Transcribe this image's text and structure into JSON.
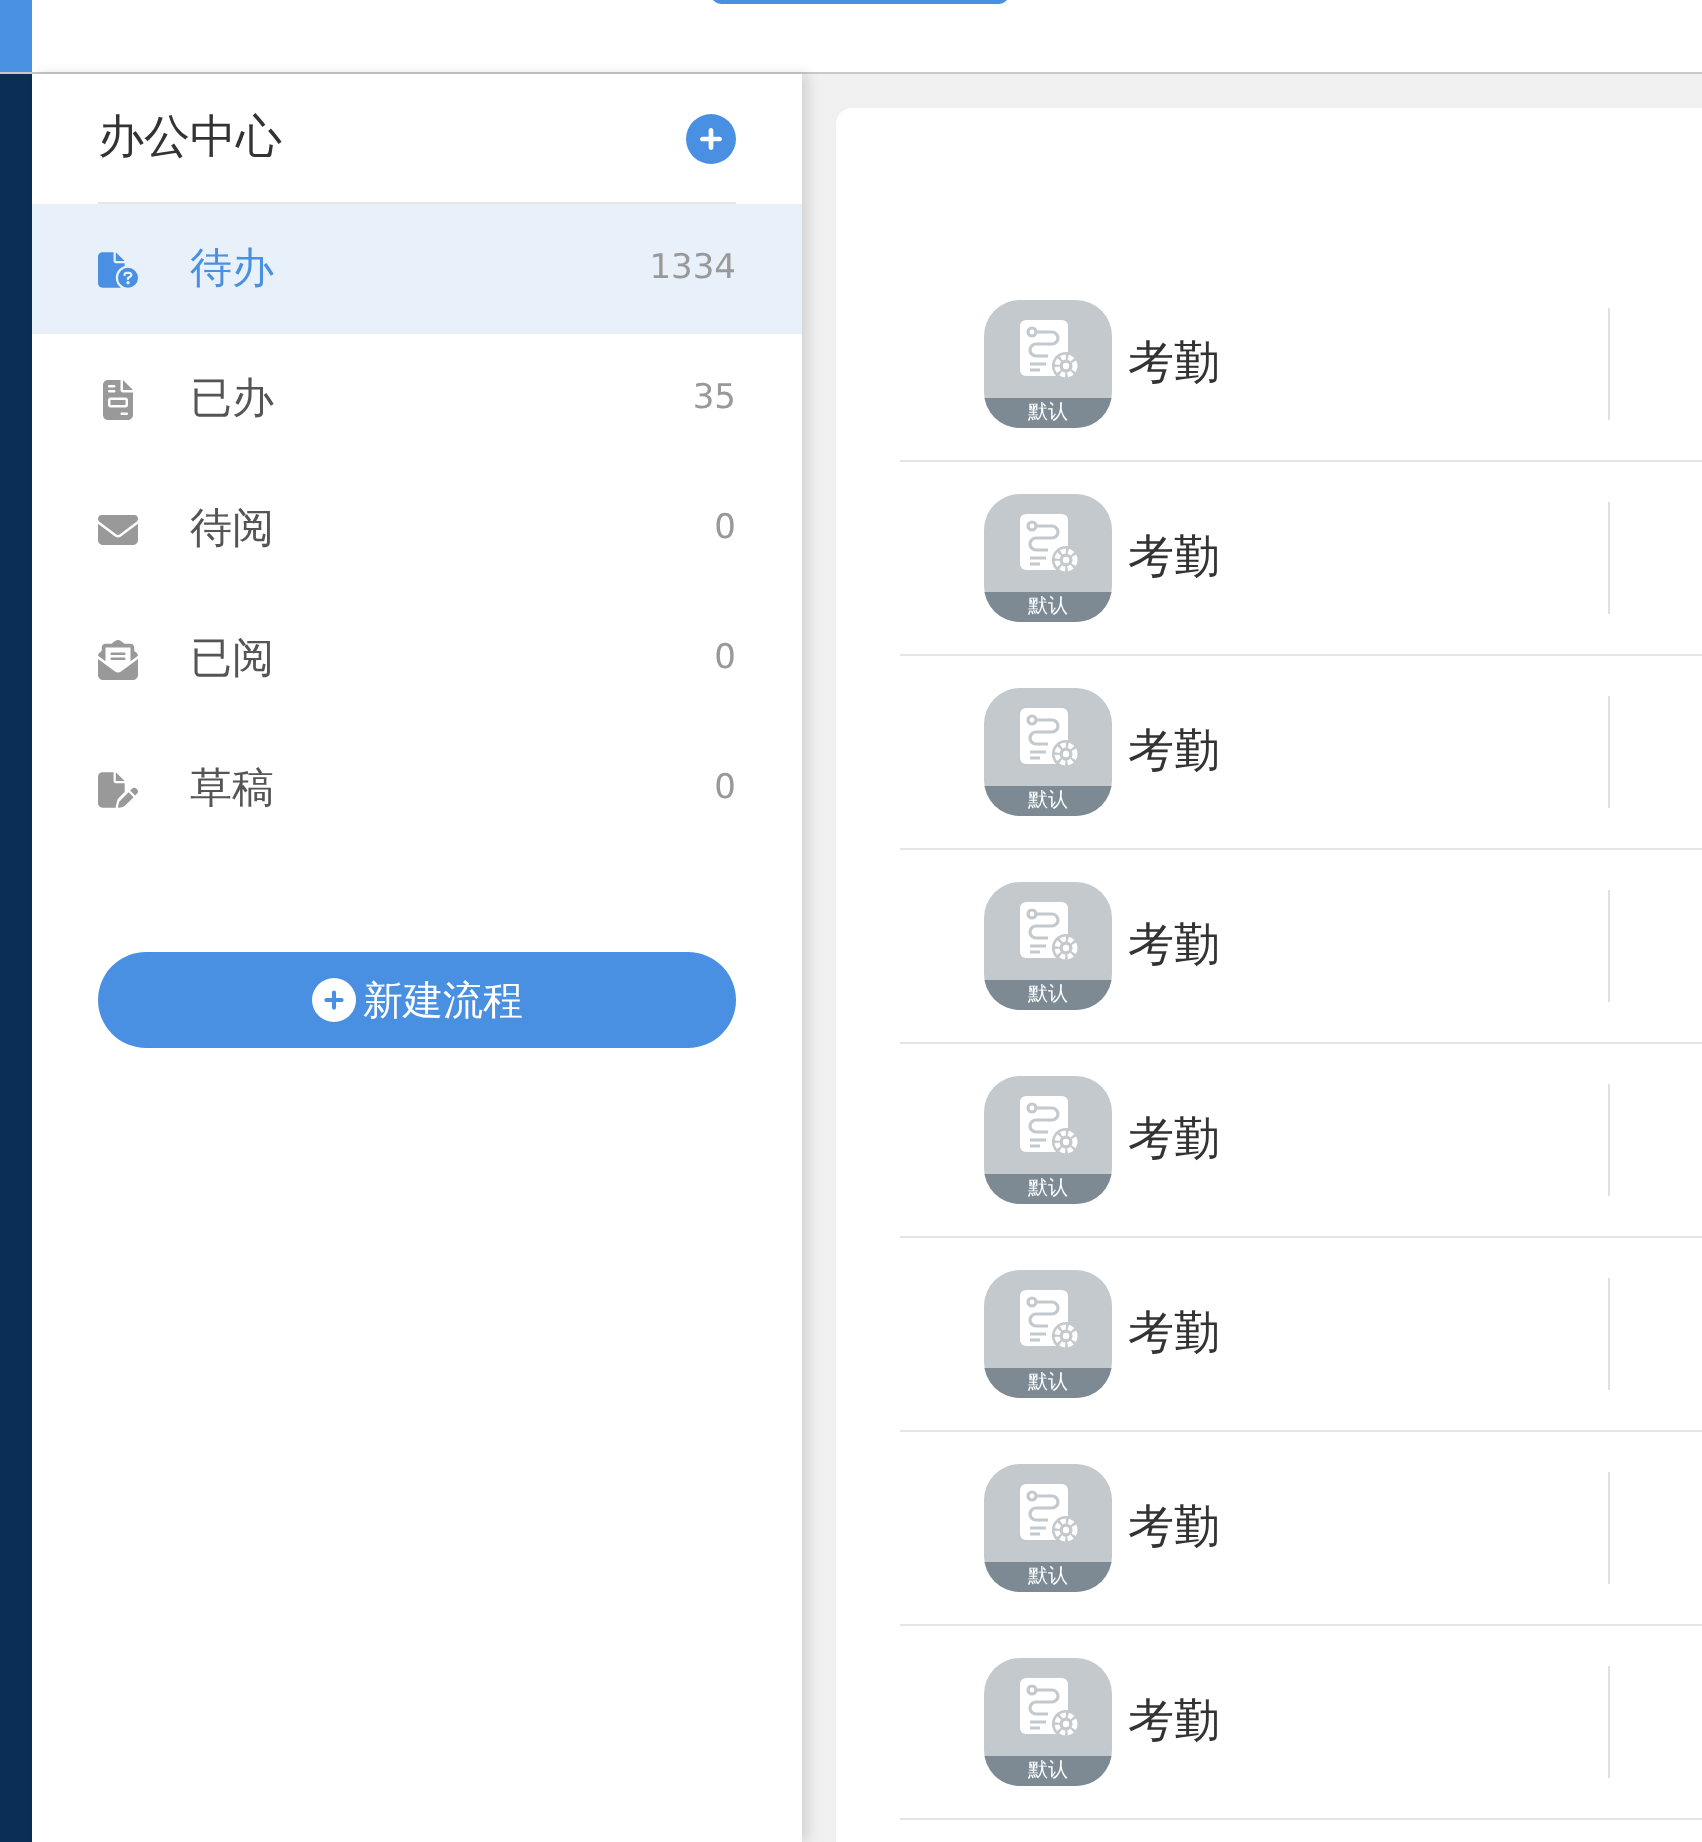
{
  "sidebar": {
    "title": "办公中心",
    "items": [
      {
        "label": "待办",
        "count": "1334",
        "selected": true
      },
      {
        "label": "已办",
        "count": "35",
        "selected": false
      },
      {
        "label": "待阅",
        "count": "0",
        "selected": false
      },
      {
        "label": "已阅",
        "count": "0",
        "selected": false
      },
      {
        "label": "草稿",
        "count": "0",
        "selected": false
      }
    ],
    "new_button": "新建流程"
  },
  "list": [
    {
      "name": "考勤",
      "badge": "默认"
    },
    {
      "name": "考勤",
      "badge": "默认"
    },
    {
      "name": "考勤",
      "badge": "默认"
    },
    {
      "name": "考勤",
      "badge": "默认"
    },
    {
      "name": "考勤",
      "badge": "默认"
    },
    {
      "name": "考勤",
      "badge": "默认"
    },
    {
      "name": "考勤",
      "badge": "默认"
    },
    {
      "name": "考勤",
      "badge": "默认"
    }
  ]
}
